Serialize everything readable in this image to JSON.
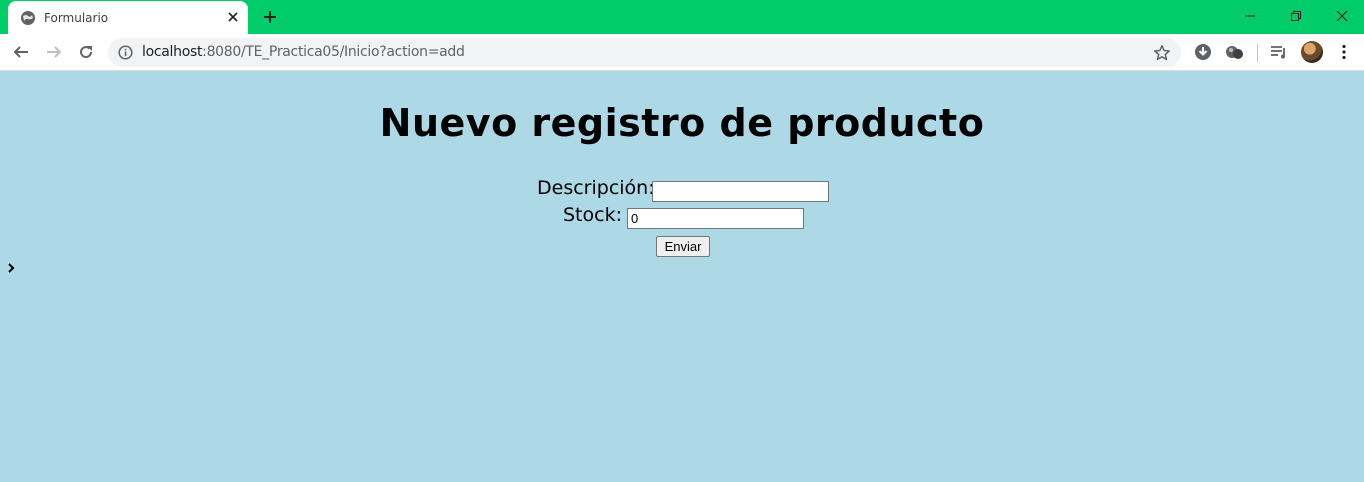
{
  "browser": {
    "tab": {
      "title": "Formulario"
    },
    "address": {
      "host": "localhost",
      "path": ":8080/TE_Practica05/Inicio?action=add"
    },
    "accent_color": "#00CC6A"
  },
  "page": {
    "background": "#ADD8E6",
    "title": "Nuevo registro de producto",
    "form": {
      "descripcion_label": "Descripción:",
      "descripcion_value": "",
      "stock_label": "Stock:",
      "stock_value": "0",
      "submit_label": "Enviar"
    }
  }
}
